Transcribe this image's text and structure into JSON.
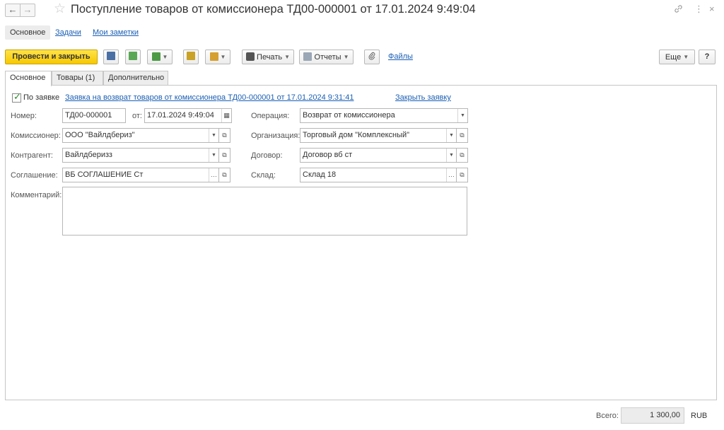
{
  "window": {
    "title": "Поступление товаров от комиссионера ТД00-000001 от 17.01.2024 9:49:04",
    "back_icon": "←",
    "forward_icon": "→",
    "star_icon": "☆",
    "link_icon": "🔗",
    "menu_icon": "⋮",
    "close_icon": "×"
  },
  "subnav": {
    "main": "Основное",
    "tasks": "Задачи",
    "notes": "Мои заметки"
  },
  "toolbar": {
    "post_close": "Провести и закрыть",
    "print": "Печать",
    "reports": "Отчеты",
    "files": "Файлы",
    "more": "Еще",
    "help": "?"
  },
  "tabs": [
    {
      "label": "Основное"
    },
    {
      "label": "Товары (1)"
    },
    {
      "label": "Дополнительно"
    }
  ],
  "form": {
    "by_request_label": "По заявке",
    "request_link": "Заявка на возврат товаров от комиссионера ТД00-000001 от 17.01.2024 9:31:41",
    "close_request": "Закрыть заявку",
    "number_label": "Номер:",
    "number_value": "ТД00-000001",
    "date_label": "от:",
    "date_value": "17.01.2024  9:49:04",
    "operation_label": "Операция:",
    "operation_value": "Возврат от комиссионера",
    "commissioner_label": "Комиссионер:",
    "commissioner_value": "ООО \"Вайлдбериз\"",
    "organization_label": "Организация:",
    "organization_value": "Торговый дом \"Комплексный\"",
    "counterparty_label": "Контрагент:",
    "counterparty_value": "Вайлдберизз",
    "contract_label": "Договор:",
    "contract_value": "Договор вб ст",
    "agreement_label": "Соглашение:",
    "agreement_value": "ВБ СОГЛАШЕНИЕ Ст",
    "warehouse_label": "Склад:",
    "warehouse_value": "Склад 18",
    "comment_label": "Комментарий:",
    "comment_value": ""
  },
  "footer": {
    "total_label": "Всего:",
    "total_value": "1 300,00",
    "currency": "RUB"
  },
  "colors": {
    "primary_button": "#f6c800",
    "link": "#1a5fb4",
    "checkbox_tick": "#2e8b2e"
  }
}
